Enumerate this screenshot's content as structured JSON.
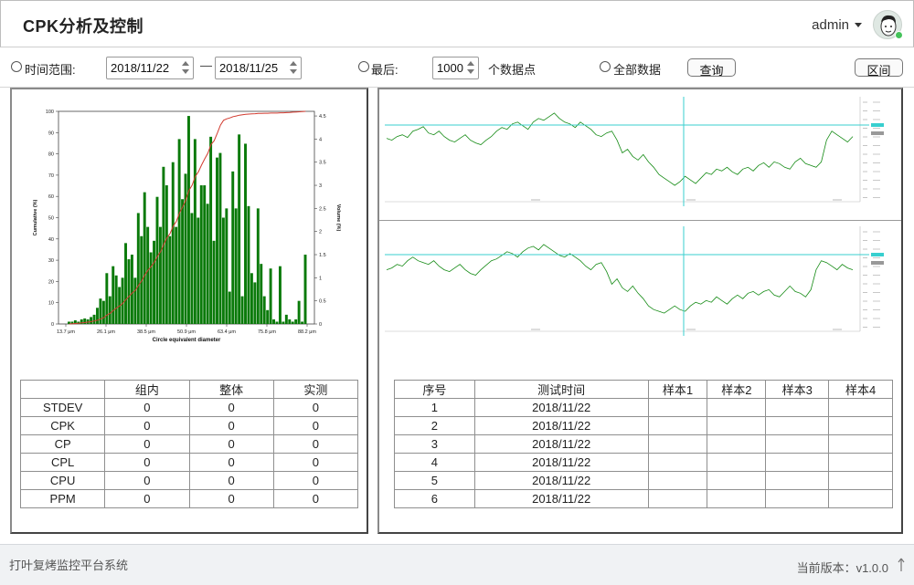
{
  "header": {
    "title": "CPK分析及控制",
    "username": "admin"
  },
  "toolbar": {
    "time_range_label": "时间范围:",
    "start_date": "2018/11/22",
    "end_date": "2018/11/25",
    "dash": "—",
    "last_label": "最后:",
    "last_count": "1000",
    "points_label": "个数据点",
    "all_data_label": "全部数据",
    "query_button": "查询",
    "range_button": "区间"
  },
  "stats_table": {
    "headers": [
      "",
      "组内",
      "整体",
      "实测"
    ],
    "rows": [
      [
        "STDEV",
        "0",
        "0",
        "0"
      ],
      [
        "CPK",
        "0",
        "0",
        "0"
      ],
      [
        "CP",
        "0",
        "0",
        "0"
      ],
      [
        "CPL",
        "0",
        "0",
        "0"
      ],
      [
        "CPU",
        "0",
        "0",
        "0"
      ],
      [
        "PPM",
        "0",
        "0",
        "0"
      ]
    ]
  },
  "data_table": {
    "headers": [
      "序号",
      "测试时间",
      "样本1",
      "样本2",
      "样本3",
      "样本4"
    ],
    "rows": [
      [
        "1",
        "2018/11/22",
        "",
        "",
        "",
        ""
      ],
      [
        "2",
        "2018/11/22",
        "",
        "",
        "",
        ""
      ],
      [
        "3",
        "2018/11/22",
        "",
        "",
        "",
        ""
      ],
      [
        "4",
        "2018/11/22",
        "",
        "",
        "",
        ""
      ],
      [
        "5",
        "2018/11/22",
        "",
        "",
        "",
        ""
      ],
      [
        "6",
        "2018/11/22",
        "",
        "",
        "",
        ""
      ]
    ]
  },
  "chart_data": [
    {
      "type": "bar",
      "xlabel": "Circle equivalent diameter",
      "ylabel": "Cumulative (%)",
      "y2label": "Volume (%)",
      "x_tick_labels": [
        "13.7 μm",
        "26.1 μm",
        "38.5 μm",
        "50.9 μm",
        "63.4 μm",
        "75.8 μm",
        "88.2 μm"
      ],
      "y_ticks": [
        "0",
        "10",
        "20",
        "30",
        "40",
        "50",
        "60",
        "70",
        "80",
        "90",
        "100"
      ],
      "y2_ticks": [
        "0",
        "0.5",
        "1",
        "1.5",
        "2",
        "2.5",
        "3",
        "3.5",
        "4",
        "4.5"
      ],
      "ylim": [
        0,
        100
      ],
      "y2lim": [
        0,
        4.6
      ],
      "bar_color": "#0a7a0a",
      "cumulative_color": "#d23a2f",
      "series": [
        {
          "values": [
            0.05,
            0.05,
            0.08,
            0.05,
            0.1,
            0.12,
            0.1,
            0.15,
            0.2,
            0.35,
            0.55,
            0.5,
            1.1,
            0.6,
            1.25,
            1.05,
            0.8,
            1.0,
            1.75,
            1.4,
            1.5,
            1.0,
            2.4,
            1.9,
            2.85,
            2.1,
            1.55,
            1.8,
            2.75,
            2.1,
            3.4,
            3.0,
            1.9,
            3.5,
            2.1,
            4.0,
            2.7,
            3.25,
            4.5,
            2.4,
            4.0,
            2.3,
            3.0,
            3.0,
            2.6,
            4.05,
            1.8,
            3.6,
            3.7,
            2.3,
            2.5,
            0.7,
            3.3,
            2.5,
            4.1,
            0.6,
            3.9,
            2.55,
            1.1,
            0.9,
            2.5,
            1.3,
            0.6,
            0.3,
            1.2,
            0.1,
            0.05,
            1.25,
            0.05,
            0.2,
            0.1,
            0.05,
            0.1,
            0.5,
            0.05,
            1.5
          ]
        },
        {
          "values": [
            0,
            0.1,
            0.2,
            0.3,
            0.5,
            0.7,
            0.9,
            1.1,
            1.4,
            1.8,
            2.4,
            3.0,
            4.2,
            5.0,
            6.3,
            7.5,
            8.5,
            9.7,
            11.5,
            13.0,
            14.6,
            15.8,
            18.2,
            20.2,
            23.1,
            25.3,
            27.0,
            29.0,
            31.8,
            34.0,
            37.4,
            40.5,
            42.5,
            46.0,
            48.2,
            52.2,
            55.0,
            58.3,
            62.8,
            65.3,
            69.3,
            71.6,
            74.7,
            77.7,
            80.3,
            84.4,
            86.2,
            89.8,
            93.5,
            95.8,
            96.5,
            96.9,
            97.5,
            97.8,
            98.2,
            98.4,
            98.6,
            98.7,
            98.8,
            98.9,
            99.0,
            99.0,
            99.1,
            99.1,
            99.2,
            99.2,
            99.2,
            99.3,
            99.3,
            99.4,
            99.5,
            99.6,
            99.7,
            99.8,
            99.9,
            100
          ]
        }
      ]
    },
    {
      "type": "line",
      "line_color": "#138a13",
      "marker_color": "#38cfcf",
      "series": [
        {
          "values": [
            0.62,
            0.6,
            0.64,
            0.66,
            0.63,
            0.7,
            0.72,
            0.75,
            0.68,
            0.66,
            0.7,
            0.64,
            0.6,
            0.58,
            0.62,
            0.66,
            0.6,
            0.57,
            0.55,
            0.6,
            0.64,
            0.7,
            0.74,
            0.72,
            0.78,
            0.8,
            0.76,
            0.72,
            0.8,
            0.84,
            0.82,
            0.86,
            0.9,
            0.84,
            0.8,
            0.78,
            0.74,
            0.8,
            0.76,
            0.72,
            0.66,
            0.64,
            0.68,
            0.7,
            0.6,
            0.46,
            0.5,
            0.42,
            0.38,
            0.44,
            0.36,
            0.3,
            0.22,
            0.18,
            0.14,
            0.1,
            0.14,
            0.2,
            0.16,
            0.12,
            0.18,
            0.24,
            0.22,
            0.28,
            0.26,
            0.3,
            0.25,
            0.22,
            0.28,
            0.3,
            0.26,
            0.32,
            0.35,
            0.3,
            0.36,
            0.34,
            0.3,
            0.28,
            0.36,
            0.4,
            0.34,
            0.32,
            0.3,
            0.36,
            0.6,
            0.7,
            0.66,
            0.62,
            0.58,
            0.64
          ]
        }
      ]
    },
    {
      "type": "line",
      "line_color": "#138a13",
      "marker_color": "#38cfcf",
      "series": [
        {
          "values": [
            0.6,
            0.62,
            0.66,
            0.64,
            0.7,
            0.74,
            0.7,
            0.68,
            0.66,
            0.7,
            0.64,
            0.6,
            0.58,
            0.62,
            0.66,
            0.6,
            0.56,
            0.54,
            0.6,
            0.65,
            0.7,
            0.72,
            0.76,
            0.8,
            0.78,
            0.74,
            0.8,
            0.84,
            0.86,
            0.82,
            0.88,
            0.84,
            0.8,
            0.76,
            0.74,
            0.78,
            0.74,
            0.7,
            0.64,
            0.6,
            0.66,
            0.68,
            0.58,
            0.44,
            0.5,
            0.4,
            0.36,
            0.42,
            0.34,
            0.28,
            0.2,
            0.16,
            0.14,
            0.12,
            0.16,
            0.2,
            0.16,
            0.14,
            0.2,
            0.24,
            0.22,
            0.26,
            0.24,
            0.3,
            0.26,
            0.22,
            0.28,
            0.32,
            0.28,
            0.34,
            0.36,
            0.32,
            0.36,
            0.38,
            0.32,
            0.3,
            0.36,
            0.42,
            0.36,
            0.34,
            0.3,
            0.38,
            0.6,
            0.7,
            0.68,
            0.64,
            0.6,
            0.66,
            0.62,
            0.6
          ]
        }
      ]
    }
  ],
  "footer": {
    "system_name": "打叶复烤监控平台系统",
    "version_label": "当前版本：v1.0.0"
  }
}
